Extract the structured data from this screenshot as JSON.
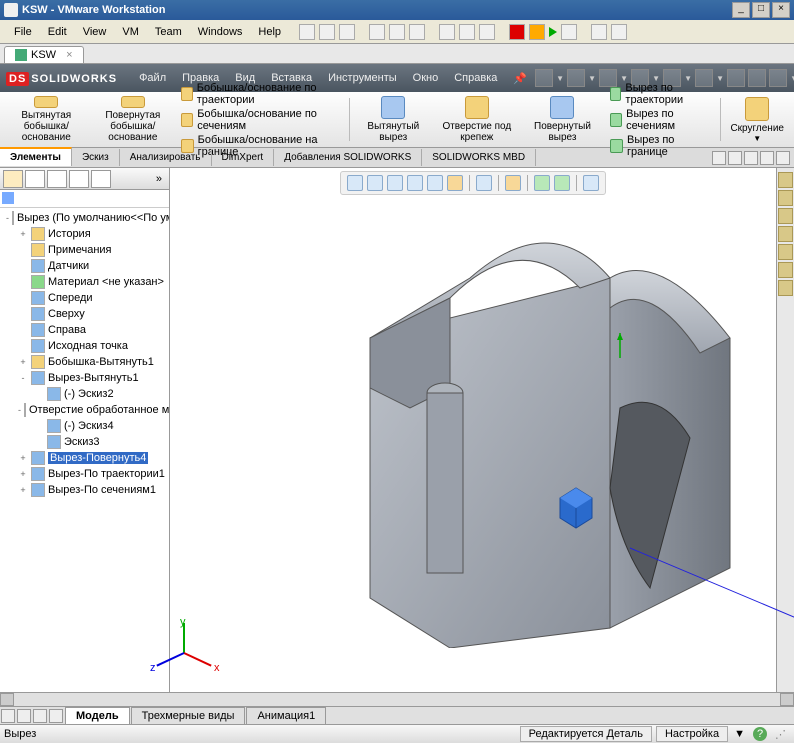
{
  "vmware": {
    "title": "KSW - VMware Workstation",
    "menu": [
      "File",
      "Edit",
      "View",
      "VM",
      "Team",
      "Windows",
      "Help"
    ],
    "tab": "KSW"
  },
  "sw": {
    "logo": "SOLIDWORKS",
    "menu": [
      "Файл",
      "Правка",
      "Вид",
      "Вставка",
      "Инструменты",
      "Окно",
      "Справка"
    ]
  },
  "ribbon": {
    "b1": "Вытянутая бобышка/основание",
    "b2": "Повернутая бобышка/основание",
    "c1": "Бобышка/основание по траектории",
    "c2": "Бобышка/основание по сечениям",
    "c3": "Бобышка/основание на границе",
    "b3": "Вытянутый вырез",
    "b4": "Отверстие под крепеж",
    "b5": "Повернутый вырез",
    "c4": "Вырез по траектории",
    "c5": "Вырез по сечениям",
    "c6": "Вырез по границе",
    "b6": "Скругление"
  },
  "tabs2": [
    "Элементы",
    "Эскиз",
    "Анализировать",
    "DimXpert",
    "Добавления SOLIDWORKS",
    "SOLIDWORKS MBD"
  ],
  "tree": {
    "root": "Вырез  (По умолчанию<<По умолч",
    "items": [
      {
        "d": 1,
        "t": "История",
        "i": "yel",
        "e": "+"
      },
      {
        "d": 1,
        "t": "Примечания",
        "i": "yel"
      },
      {
        "d": 1,
        "t": "Датчики",
        "i": "blu"
      },
      {
        "d": 1,
        "t": "Материал <не указан>",
        "i": "grn"
      },
      {
        "d": 1,
        "t": "Спереди",
        "i": "blu"
      },
      {
        "d": 1,
        "t": "Сверху",
        "i": "blu"
      },
      {
        "d": 1,
        "t": "Справа",
        "i": "blu"
      },
      {
        "d": 1,
        "t": "Исходная точка",
        "i": "blu"
      },
      {
        "d": 1,
        "t": "Бобышка-Вытянуть1",
        "i": "yel",
        "e": "+"
      },
      {
        "d": 1,
        "t": "Вырез-Вытянуть1",
        "i": "blu",
        "e": "-"
      },
      {
        "d": 2,
        "t": "(-) Эскиз2",
        "i": "blu"
      },
      {
        "d": 1,
        "t": "Отверстие обработанное метч",
        "i": "yel",
        "e": "-"
      },
      {
        "d": 2,
        "t": "(-) Эскиз4",
        "i": "blu"
      },
      {
        "d": 2,
        "t": "Эскиз3",
        "i": "blu"
      },
      {
        "d": 1,
        "t": "Вырез-Повернуть4",
        "i": "blu",
        "e": "+",
        "sel": true
      },
      {
        "d": 1,
        "t": "Вырез-По траектории1",
        "i": "blu",
        "e": "+"
      },
      {
        "d": 1,
        "t": "Вырез-По сечениям1",
        "i": "blu",
        "e": "+"
      }
    ]
  },
  "btabs": [
    "Модель",
    "Трехмерные виды",
    "Анимация1"
  ],
  "status": {
    "left": "Вырез",
    "mid": "Редактируется Деталь",
    "right": "Настройка"
  },
  "triad": {
    "x": "x",
    "y": "y",
    "z": "z"
  }
}
